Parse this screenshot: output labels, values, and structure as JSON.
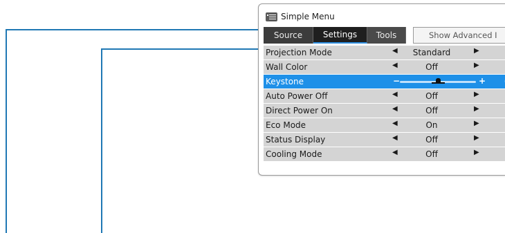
{
  "window": {
    "title": "Simple Menu",
    "icon": "menu-list-icon"
  },
  "tabs": [
    {
      "label": "Source",
      "active": false
    },
    {
      "label": "Settings",
      "active": true
    },
    {
      "label": "Tools",
      "active": false
    }
  ],
  "advanced_button": {
    "label": "Show Advanced I"
  },
  "rows": [
    {
      "label": "Projection Mode",
      "value": "Standard",
      "left_arrow": "◀",
      "right_arrow": "▶"
    },
    {
      "label": "Wall Color",
      "value": "Off",
      "left_arrow": "◀",
      "right_arrow": "▶"
    },
    {
      "label": "Keystone",
      "value": "0",
      "minus": "−",
      "plus": "+",
      "slider_level": 0.5,
      "selected": true
    },
    {
      "label": "Auto Power Off",
      "value": "Off",
      "left_arrow": "◀",
      "right_arrow": "▶"
    },
    {
      "label": "Direct Power On",
      "value": "Off",
      "left_arrow": "◀",
      "right_arrow": "▶"
    },
    {
      "label": "Eco Mode",
      "value": "On",
      "left_arrow": "◀",
      "right_arrow": "▶"
    },
    {
      "label": "Status Display",
      "value": "Off",
      "left_arrow": "◀",
      "right_arrow": "▶"
    },
    {
      "label": "Cooling Mode",
      "value": "Off",
      "left_arrow": "◀",
      "right_arrow": "▶"
    }
  ],
  "colors": {
    "callout_line": "#1f78b4",
    "selected_row": "#1e90e8",
    "row_background": "#d4d4d4",
    "tab_background": "#3c3c3c",
    "active_tab": "#1f1f1f"
  }
}
